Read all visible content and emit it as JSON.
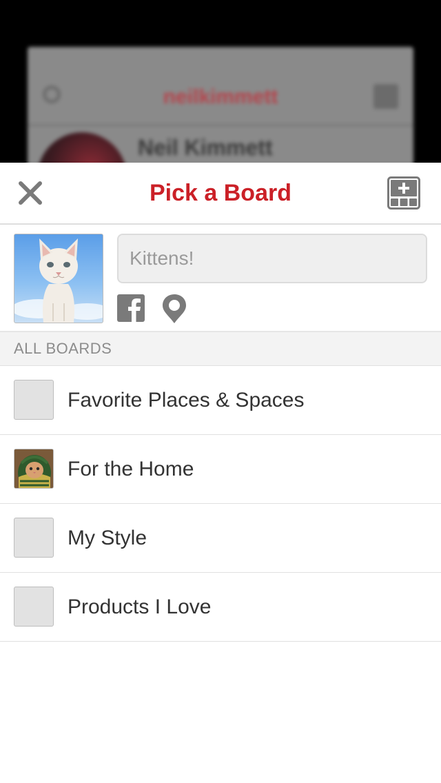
{
  "background_app": {
    "username": "neilkimmett",
    "profile_name": "Neil Kimmett"
  },
  "header": {
    "title": "Pick a Board",
    "close_icon": "close-icon",
    "add_board_icon": "add-board-icon"
  },
  "pin": {
    "description_placeholder": "Kittens!",
    "share_icons": [
      "facebook-icon",
      "place-icon"
    ]
  },
  "boards_section": {
    "header": "ALL BOARDS",
    "items": [
      {
        "label": "Favorite Places & Spaces",
        "has_thumbnail": false
      },
      {
        "label": "For the Home",
        "has_thumbnail": true
      },
      {
        "label": "My Style",
        "has_thumbnail": false
      },
      {
        "label": "Products I Love",
        "has_thumbnail": false
      }
    ]
  },
  "colors": {
    "accent": "#cb2027",
    "text": "#333333",
    "muted": "#8c8c8c"
  }
}
